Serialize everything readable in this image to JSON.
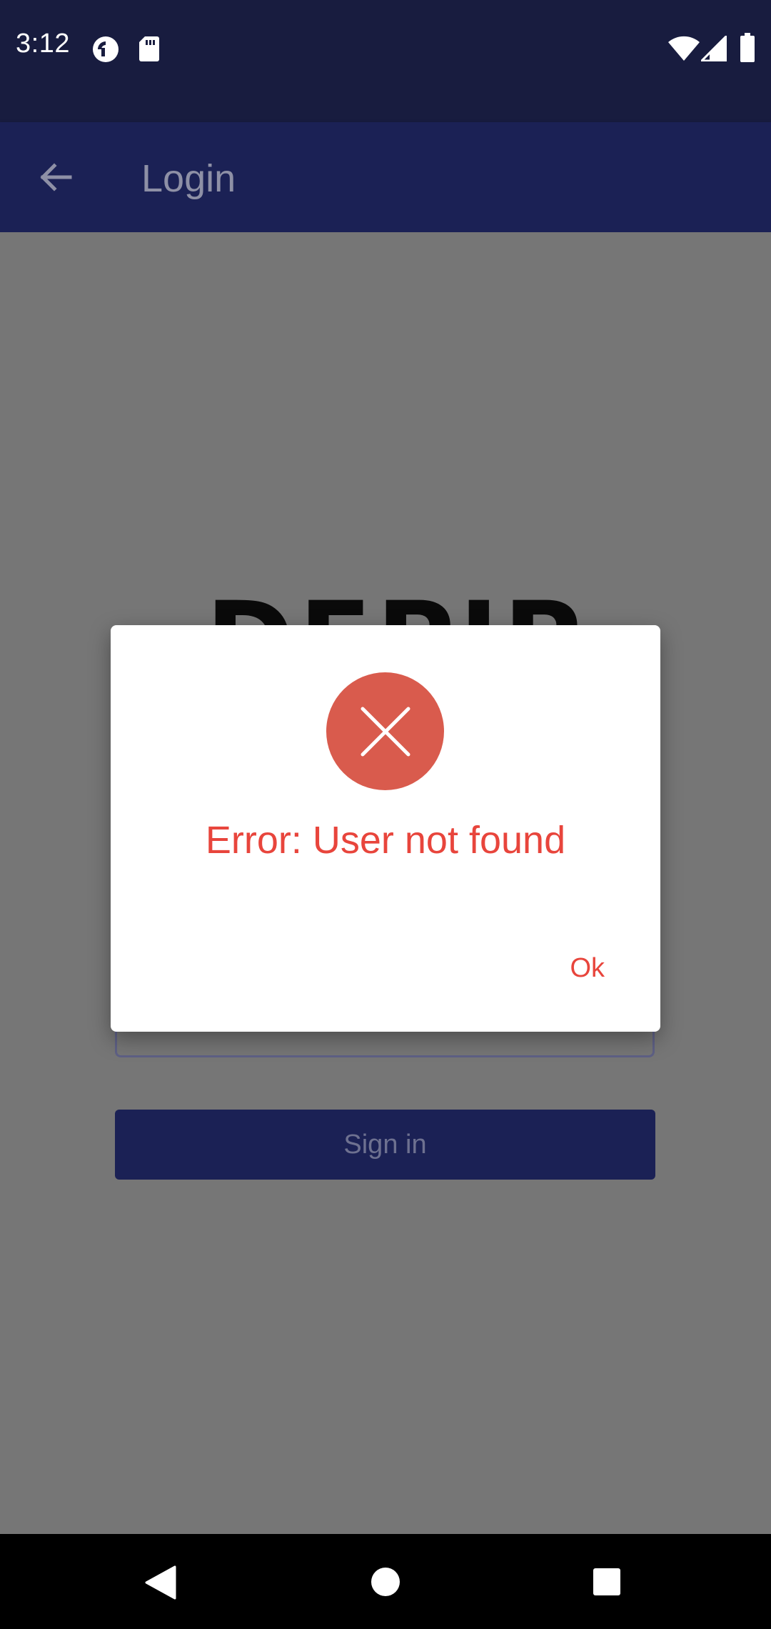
{
  "status_bar": {
    "time": "3:12",
    "icons": [
      "pocket-casts-icon",
      "sd-card-icon",
      "wifi-icon",
      "cell-signal-icon",
      "battery-icon"
    ]
  },
  "app_bar": {
    "title": "Login",
    "back_icon": "arrow-back-icon"
  },
  "login_form": {
    "logo_text": "DEPIPEA",
    "sign_in_label": "Sign in"
  },
  "dialog": {
    "icon": "error-x-icon",
    "message": "Error: User not found",
    "ok_label": "Ok"
  },
  "nav_bar": {
    "icons": [
      "back-triangle-icon",
      "home-circle-icon",
      "recents-square-icon"
    ]
  },
  "colors": {
    "status_bar": "#181c3f",
    "app_bar": "#1b2155",
    "scrim": "#767676",
    "error": "#e8453c",
    "error_circle": "#d95b4d"
  }
}
